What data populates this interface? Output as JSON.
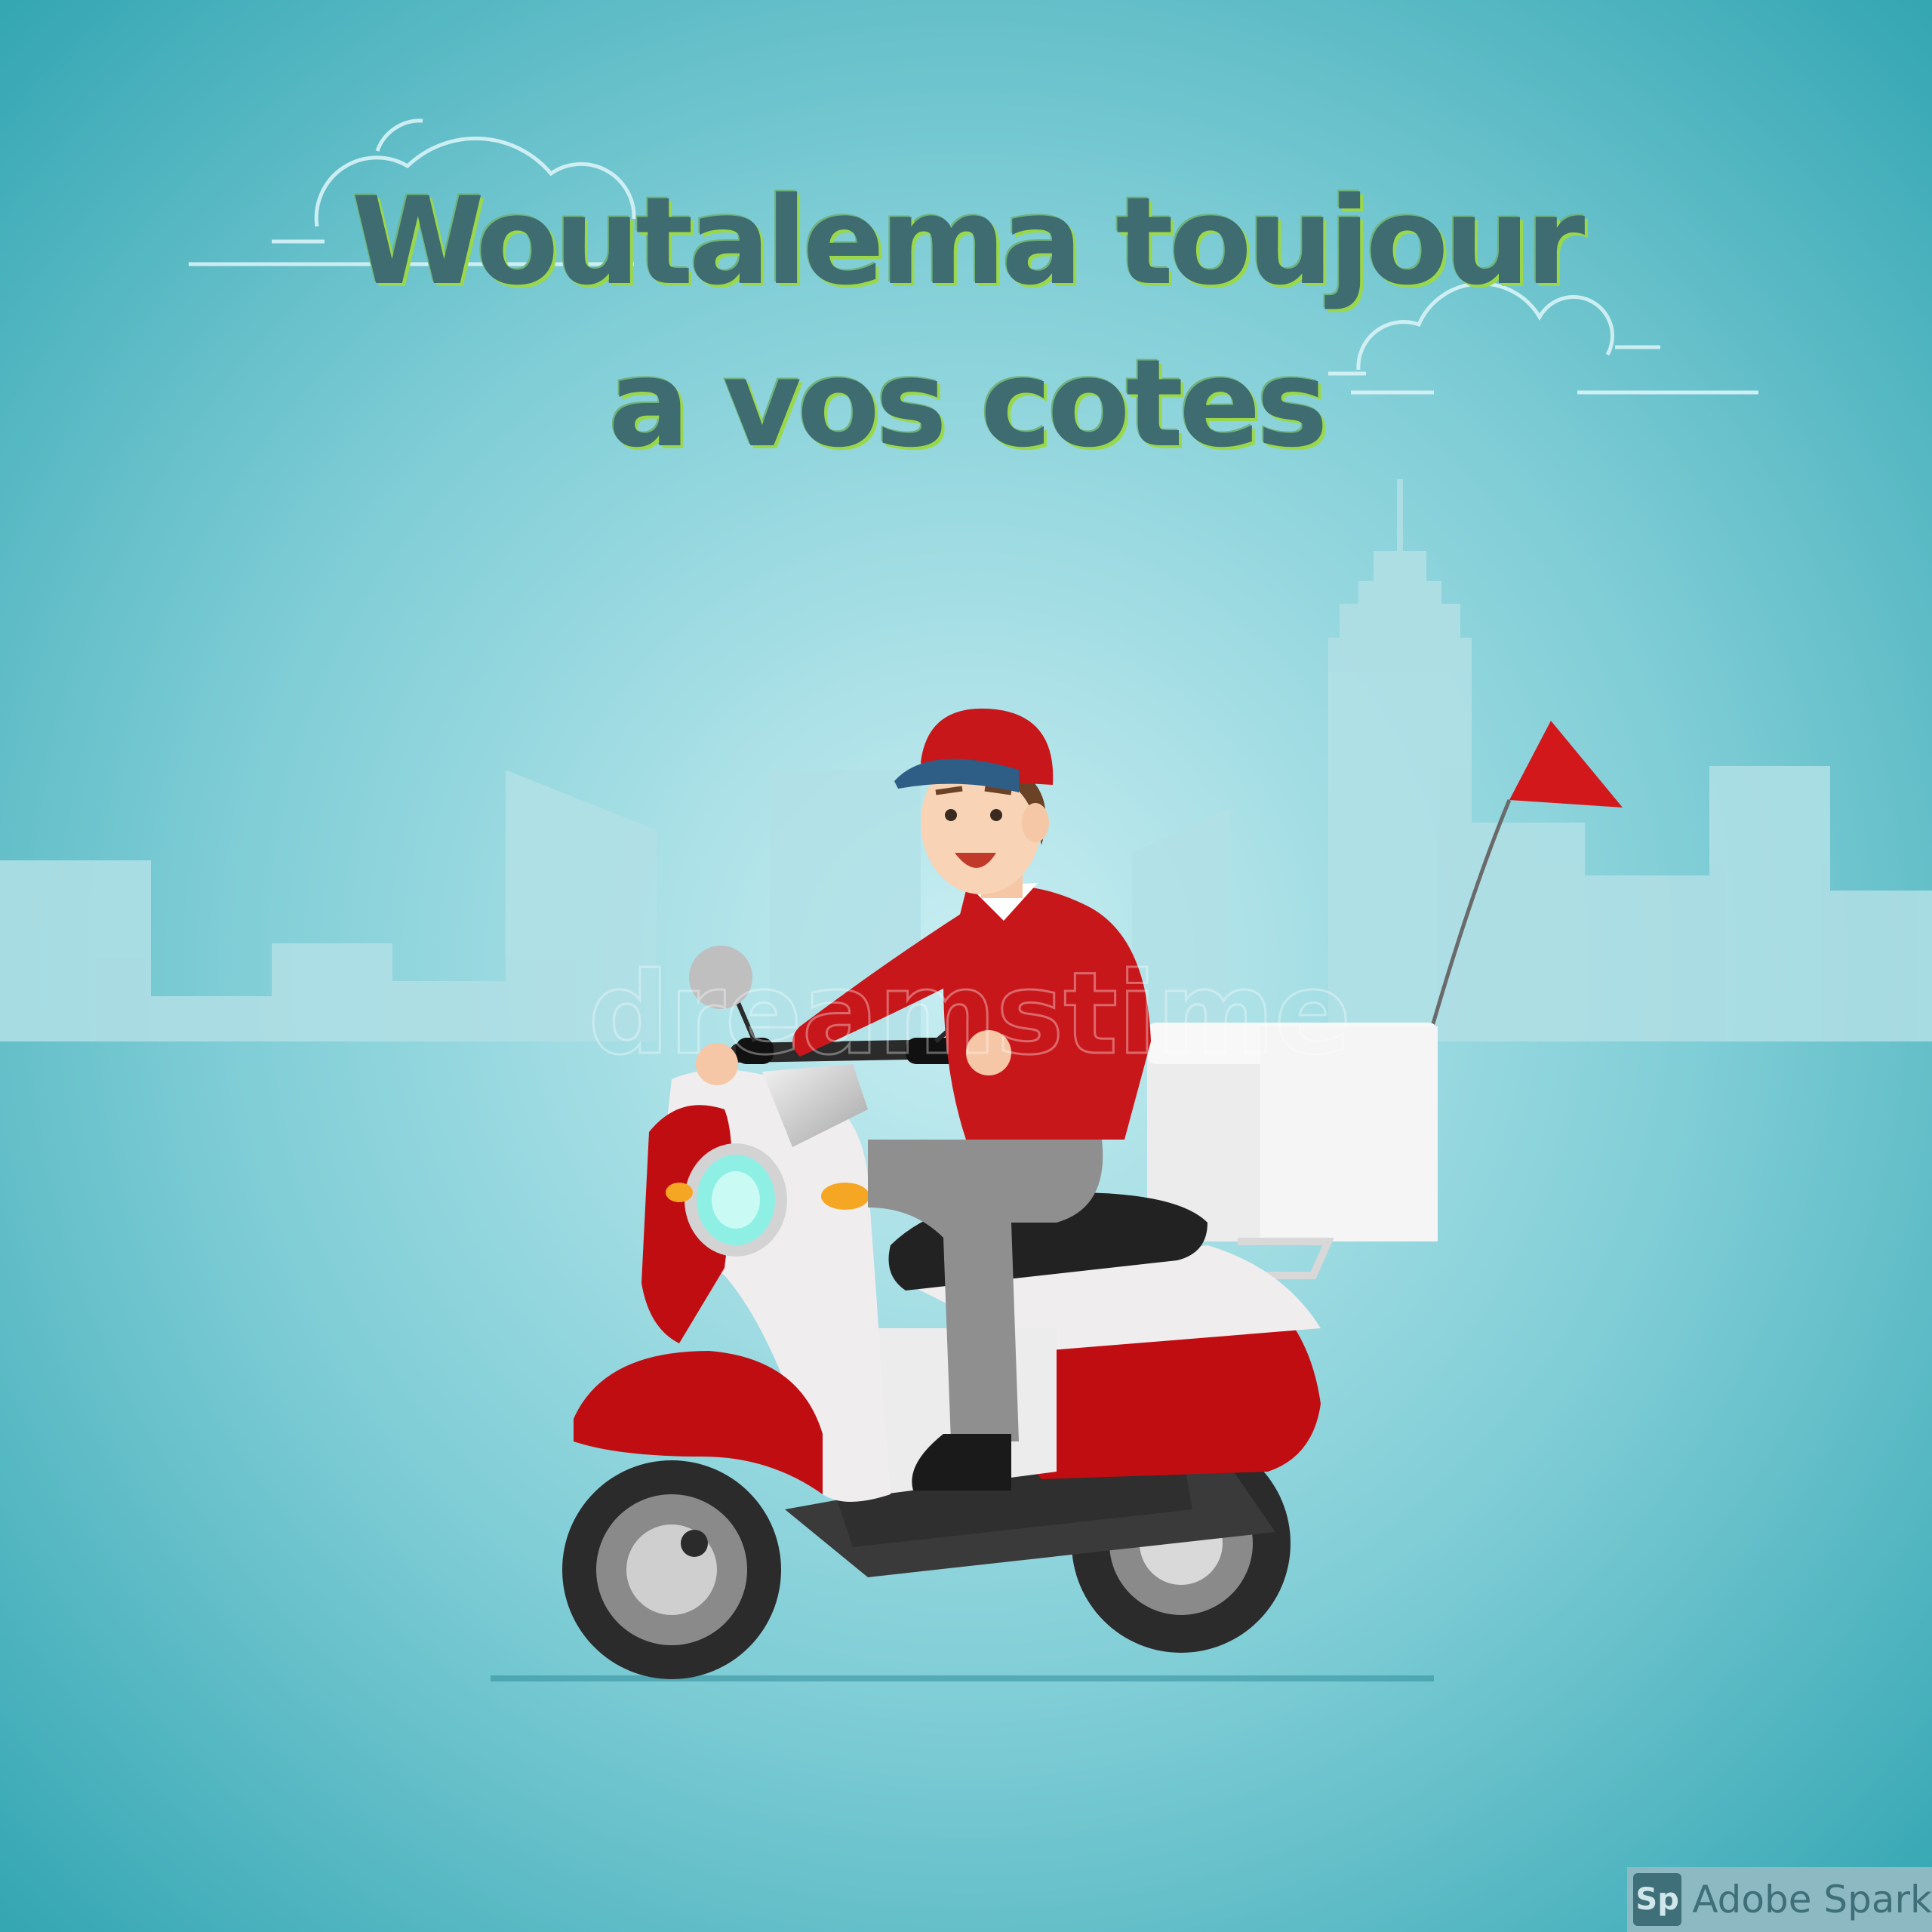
{
  "headline": {
    "line1": "Woutalema toujour",
    "line2": "a vos cotes"
  },
  "watermark": {
    "logo_letters": "Sp",
    "label": "Adobe Spark"
  },
  "stock_watermark": "dreamstime",
  "colors": {
    "background_center": "#c8eef2",
    "background_edge": "#35a7b3",
    "scooter_red": "#c00d12",
    "jacket_red": "#c8171b",
    "cap_visor": "#2e5d86",
    "headline_text": "#3e6c70",
    "headline_outline": "#9ad84a"
  },
  "icons": [
    "delivery-rider-illustration",
    "scooter",
    "delivery-box",
    "red-pennant-flag",
    "cloud-outline",
    "city-skyline"
  ]
}
